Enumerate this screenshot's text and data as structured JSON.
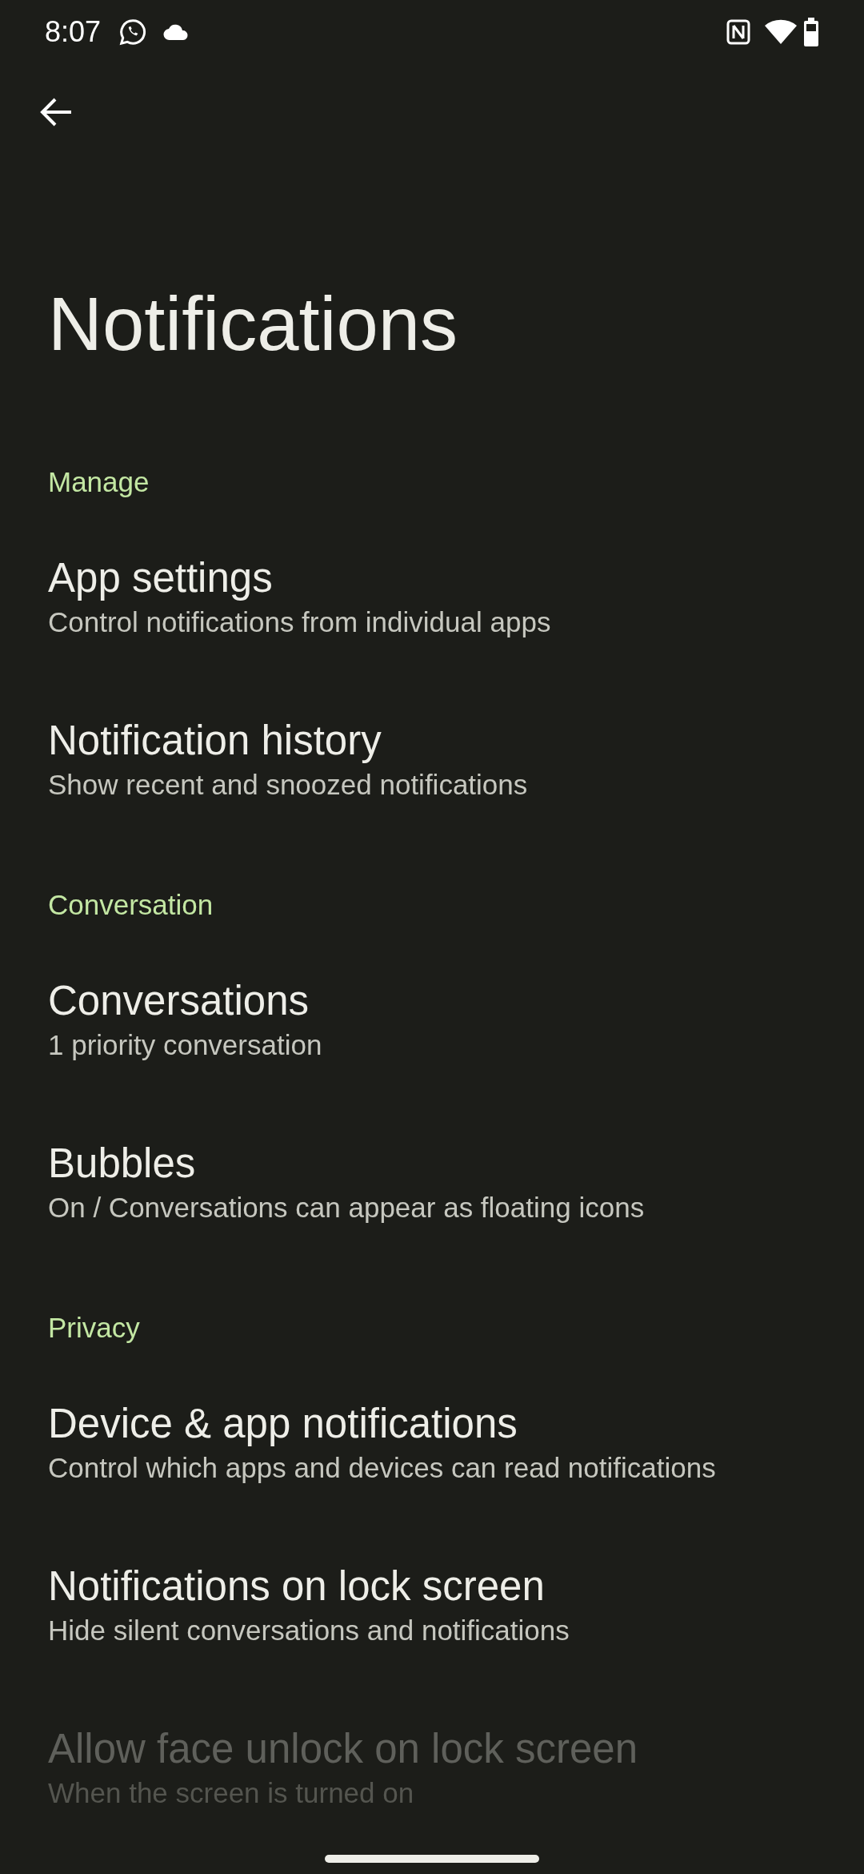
{
  "status_bar": {
    "time": "8:07"
  },
  "title": "Notifications",
  "sections": [
    {
      "header": "Manage",
      "items": [
        {
          "title": "App settings",
          "subtitle": "Control notifications from individual apps",
          "disabled": false
        },
        {
          "title": "Notification history",
          "subtitle": "Show recent and snoozed notifications",
          "disabled": false
        }
      ]
    },
    {
      "header": "Conversation",
      "items": [
        {
          "title": "Conversations",
          "subtitle": "1 priority conversation",
          "disabled": false
        },
        {
          "title": "Bubbles",
          "subtitle": "On / Conversations can appear as floating icons",
          "disabled": false
        }
      ]
    },
    {
      "header": "Privacy",
      "items": [
        {
          "title": "Device & app notifications",
          "subtitle": "Control which apps and devices can read notifications",
          "disabled": false
        },
        {
          "title": "Notifications on lock screen",
          "subtitle": "Hide silent conversations and notifications",
          "disabled": false
        },
        {
          "title": "Allow face unlock on lock screen",
          "subtitle": "When the screen is turned on",
          "disabled": true
        }
      ]
    }
  ]
}
